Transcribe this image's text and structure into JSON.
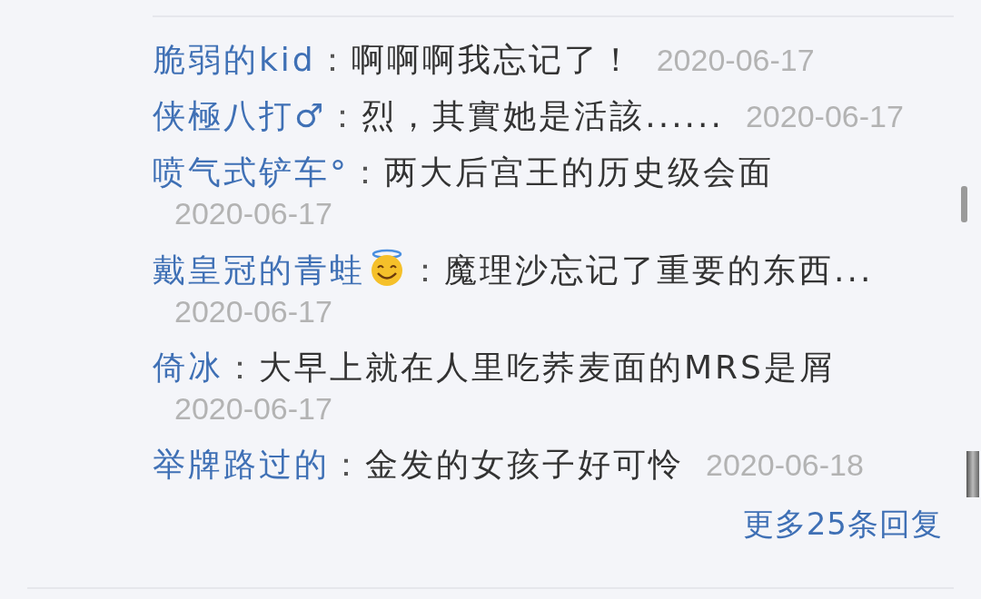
{
  "replies": [
    {
      "kind": "plain",
      "name": "脆弱的kid",
      "separator": "：",
      "text": "啊啊啊我忘记了！",
      "date": "2020-06-17"
    },
    {
      "kind": "plain",
      "name": "侠極八打♂",
      "separator": "：",
      "text": "烈，其實她是活該......",
      "date": "2020-06-17"
    },
    {
      "kind": "plain",
      "name": "喷气式铲车°",
      "separator": "：",
      "text": "两大后宫王的历史级会面",
      "date": "2020-06-17"
    },
    {
      "kind": "emoji",
      "name": "戴皇冠的青蛙",
      "separator": "：",
      "text": "魔理沙忘记了重要的东西...",
      "date": "2020-06-17"
    },
    {
      "kind": "plain",
      "name": "倚冰",
      "separator": "：",
      "text": "大早上就在人里吃荞麦面的MRS是屑",
      "date": "2020-06-17"
    },
    {
      "kind": "plain",
      "name": "举牌路过的",
      "separator": "：",
      "text": "金发的女孩子好可怜",
      "date": "2020-06-18"
    }
  ],
  "more_link": "更多25条回复"
}
